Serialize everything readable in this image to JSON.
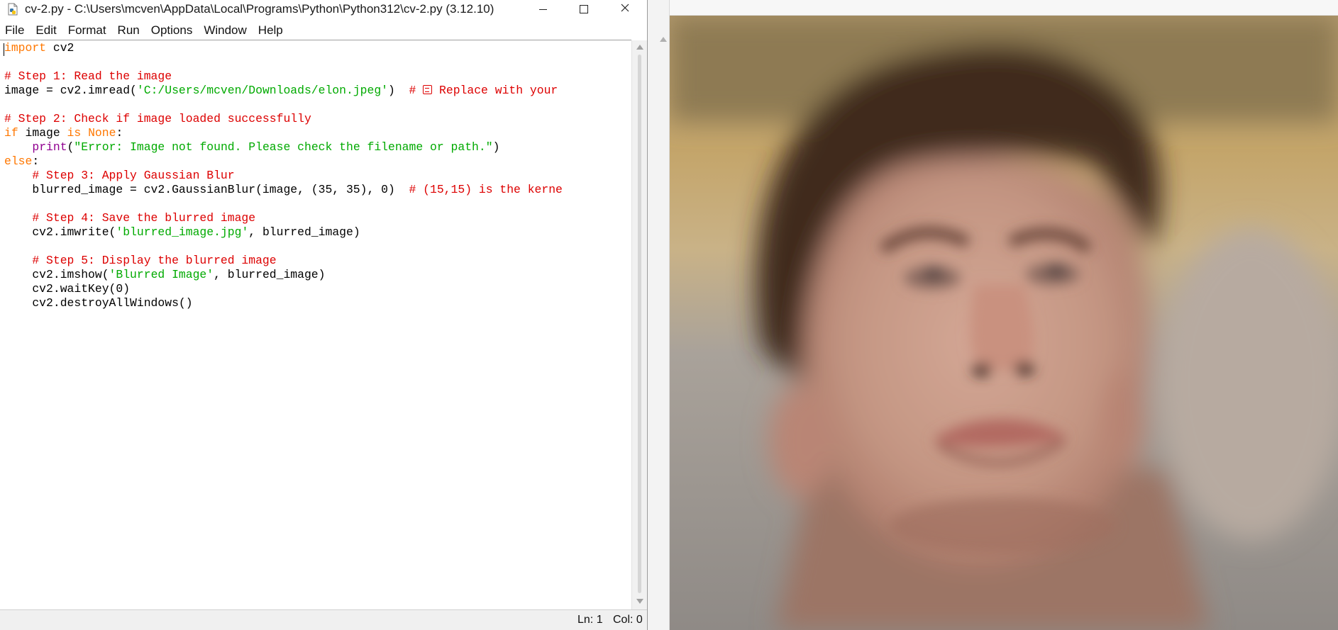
{
  "window": {
    "title": "cv-2.py - C:\\Users\\mcven\\AppData\\Local\\Programs\\Python\\Python312\\cv-2.py (3.12.10)",
    "controls": {
      "minimize": "—",
      "maximize": "☐",
      "close": "✕"
    }
  },
  "menu": [
    "File",
    "Edit",
    "Format",
    "Run",
    "Options",
    "Window",
    "Help"
  ],
  "code": {
    "l1_kw": "import",
    "l1_rest": " cv2",
    "l3": "# Step 1: Read the image",
    "l4_a": "image = cv2.imread(",
    "l4_str": "'C:/Users/mcven/Downloads/elon.jpeg'",
    "l4_b": ")  ",
    "l4_c1": "# ",
    "l4_c2": " Replace with your",
    "l6": "# Step 2: Check if image loaded successfully",
    "l7_if": "if",
    "l7_a": " image ",
    "l7_is": "is",
    "l7_none": "None",
    "l7_colon": ":",
    "l8_ind": "    ",
    "l8_print": "print",
    "l8_p1": "(",
    "l8_str": "\"Error: Image not found. Please check the filename or path.\"",
    "l8_p2": ")",
    "l9_else": "else",
    "l9_colon": ":",
    "l10": "    # Step 3: Apply Gaussian Blur",
    "l11_a": "    blurred_image = cv2.GaussianBlur(image, (35, 35), 0)  ",
    "l11_c": "# (15,15) is the kerne",
    "l13": "    # Step 4: Save the blurred image",
    "l14_a": "    cv2.imwrite(",
    "l14_str": "'blurred_image.jpg'",
    "l14_b": ", blurred_image)",
    "l16": "    # Step 5: Display the blurred image",
    "l17_a": "    cv2.imshow(",
    "l17_str": "'Blurred Image'",
    "l17_b": ", blurred_image)",
    "l18": "    cv2.waitKey(0)",
    "l19": "    cv2.destroyAllWindows()"
  },
  "status": {
    "line": "Ln: 1",
    "col": "Col: 0"
  },
  "image_window": {
    "content": "blurred-portrait"
  },
  "colors": {
    "keyword": "#ff7700",
    "comment": "#dd0000",
    "string": "#00aa00",
    "builtin": "#900090"
  }
}
